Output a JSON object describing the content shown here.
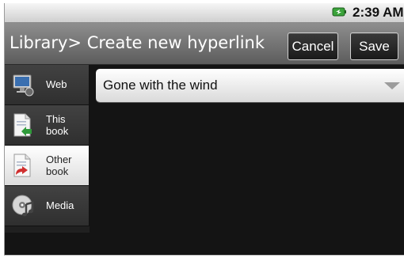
{
  "status_bar": {
    "time": "2:39 AM",
    "battery_icon": "battery-icon",
    "battery_color": "#3aa33a"
  },
  "title_bar": {
    "title": "Library> Create new hyperlink",
    "cancel_label": "Cancel",
    "save_label": "Save"
  },
  "sidebar": {
    "items": [
      {
        "label": "Web",
        "icon": "monitor-globe-icon",
        "selected": false
      },
      {
        "label_line1": "This",
        "label_line2": "book",
        "icon": "document-arrow-icon",
        "selected": false
      },
      {
        "label_line1": "Other",
        "label_line2": "book",
        "icon": "document-red-arrow-icon",
        "selected": true
      },
      {
        "label": "Media",
        "icon": "disc-music-icon",
        "selected": false
      }
    ]
  },
  "book_selector": {
    "value": "Gone with the wind"
  },
  "colors": {
    "background": "#141414",
    "title_bar": "#6f6f6f",
    "selected_item": "#f0f0f0"
  }
}
